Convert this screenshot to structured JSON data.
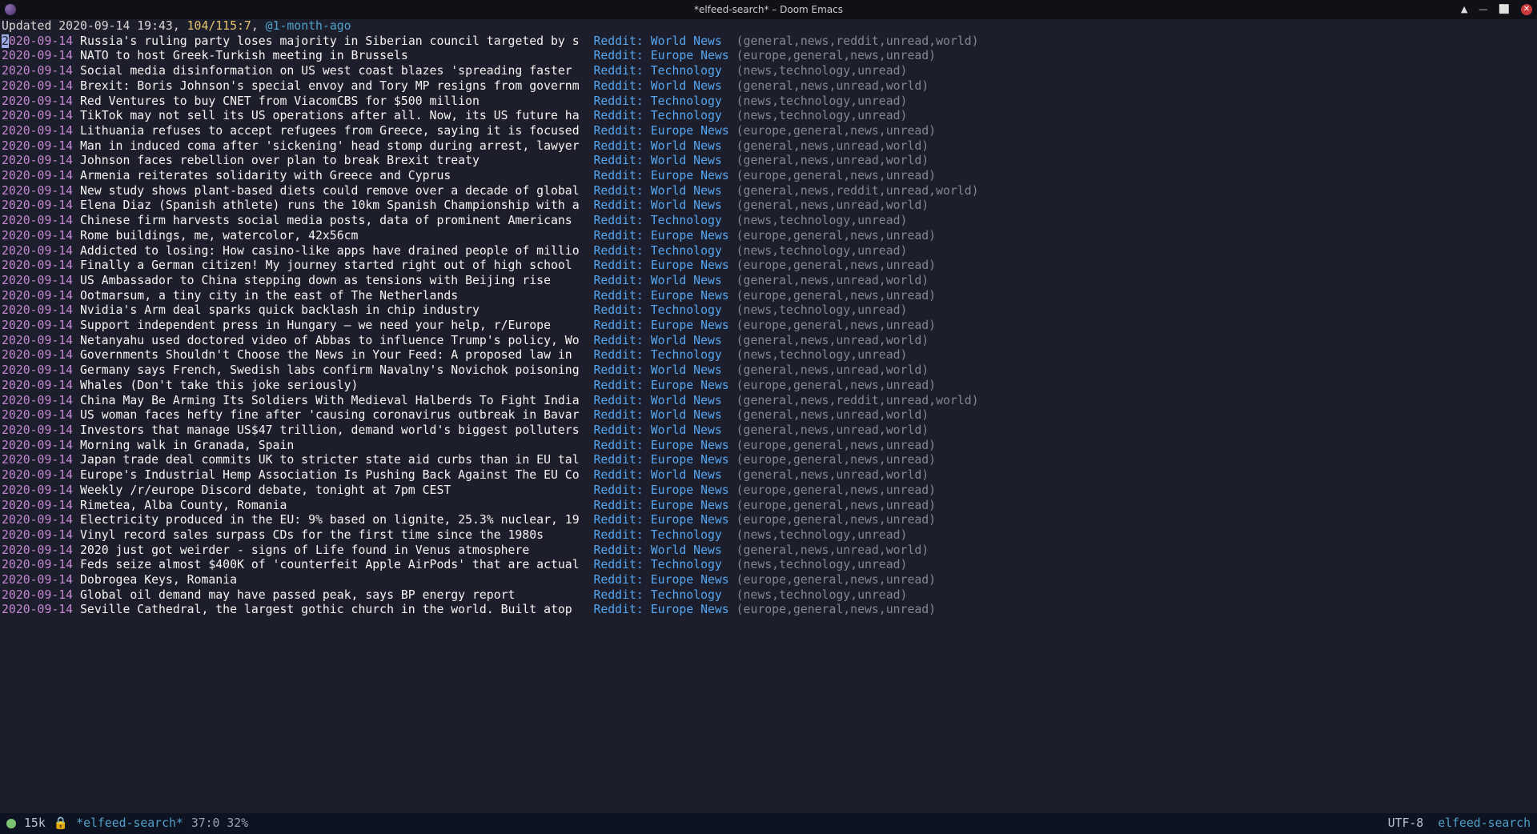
{
  "titlebar": {
    "text": "*elfeed-search* – Doom Emacs"
  },
  "header": {
    "updated_label": "Updated",
    "updated_time": "2020-09-14 19:43",
    "count": "104/115:7",
    "age": "@1-month-ago"
  },
  "feeds": {
    "world": "Reddit: World News",
    "europe": "Reddit: Europe News",
    "tech": "Reddit: Technology"
  },
  "tag_strings": {
    "world": "(general,news,unread,world)",
    "world_reddit": "(general,news,reddit,unread,world)",
    "europe": "(europe,general,news,unread)",
    "tech": "(news,technology,unread)"
  },
  "date": "2020-09-14",
  "entries": [
    {
      "t": "Russia's ruling party loses majority in Siberian council targeted by s",
      "f": "world",
      "tags": "world_reddit",
      "cursor": true
    },
    {
      "t": "NATO to host Greek-Turkish meeting in Brussels",
      "f": "europe",
      "tags": "europe"
    },
    {
      "t": "Social media disinformation on US west coast blazes 'spreading faster",
      "f": "tech",
      "tags": "tech"
    },
    {
      "t": "Brexit: Boris Johnson's special envoy and Tory MP resigns from governm",
      "f": "world",
      "tags": "world"
    },
    {
      "t": "Red Ventures to buy CNET from ViacomCBS for $500 million",
      "f": "tech",
      "tags": "tech"
    },
    {
      "t": "TikTok may not sell its US operations after all. Now, its US future ha",
      "f": "tech",
      "tags": "tech"
    },
    {
      "t": "Lithuania refuses to accept refugees from Greece, saying it is focused",
      "f": "europe",
      "tags": "europe"
    },
    {
      "t": "Man in induced coma after 'sickening' head stomp during arrest, lawyer",
      "f": "world",
      "tags": "world"
    },
    {
      "t": "Johnson faces rebellion over plan to break Brexit treaty",
      "f": "world",
      "tags": "world"
    },
    {
      "t": "Armenia reiterates solidarity with Greece and Cyprus",
      "f": "europe",
      "tags": "europe"
    },
    {
      "t": "New study shows plant-based diets could remove over a decade of global",
      "f": "world",
      "tags": "world_reddit"
    },
    {
      "t": "Elena Diaz (Spanish athlete) runs the 10km Spanish Championship with a",
      "f": "world",
      "tags": "world"
    },
    {
      "t": "Chinese firm harvests social media posts, data of prominent Americans",
      "f": "tech",
      "tags": "tech"
    },
    {
      "t": "Rome buildings, me, watercolor, 42x56cm",
      "f": "europe",
      "tags": "europe"
    },
    {
      "t": "Addicted to losing: How casino-like apps have drained people of millio",
      "f": "tech",
      "tags": "tech"
    },
    {
      "t": "Finally a German citizen! My journey started right out of high school",
      "f": "europe",
      "tags": "europe"
    },
    {
      "t": "US Ambassador to China stepping down as tensions with Beijing rise",
      "f": "world",
      "tags": "world"
    },
    {
      "t": "Ootmarsum, a tiny city in the east of The Netherlands",
      "f": "europe",
      "tags": "europe"
    },
    {
      "t": "Nvidia's Arm deal sparks quick backlash in chip industry",
      "f": "tech",
      "tags": "tech"
    },
    {
      "t": "Support independent press in Hungary – we need your help, r/Europe",
      "f": "europe",
      "tags": "europe"
    },
    {
      "t": "Netanyahu used doctored video of Abbas to influence Trump's policy, Wo",
      "f": "world",
      "tags": "world"
    },
    {
      "t": "Governments Shouldn't Choose the News in Your Feed: A proposed law in",
      "f": "tech",
      "tags": "tech"
    },
    {
      "t": "Germany says French, Swedish labs confirm Navalny's Novichok poisoning",
      "f": "world",
      "tags": "world"
    },
    {
      "t": "Whales (Don't take this joke seriously)",
      "f": "europe",
      "tags": "europe"
    },
    {
      "t": "China May Be Arming Its Soldiers With Medieval Halberds To Fight India",
      "f": "world",
      "tags": "world_reddit"
    },
    {
      "t": "US woman faces hefty fine after 'causing coronavirus outbreak in Bavar",
      "f": "world",
      "tags": "world"
    },
    {
      "t": "Investors that manage US$47 trillion, demand world's biggest polluters",
      "f": "world",
      "tags": "world"
    },
    {
      "t": "Morning walk in Granada, Spain",
      "f": "europe",
      "tags": "europe"
    },
    {
      "t": "Japan trade deal commits UK to stricter state aid curbs than in EU tal",
      "f": "europe",
      "tags": "europe"
    },
    {
      "t": "Europe's Industrial Hemp Association Is Pushing Back Against The EU Co",
      "f": "world",
      "tags": "world"
    },
    {
      "t": "Weekly /r/europe Discord debate, tonight at 7pm CEST",
      "f": "europe",
      "tags": "europe"
    },
    {
      "t": "Rimetea, Alba County, Romania",
      "f": "europe",
      "tags": "europe"
    },
    {
      "t": "Electricity produced in the EU: 9% based on lignite, 25.3% nuclear, 19",
      "f": "europe",
      "tags": "europe"
    },
    {
      "t": "Vinyl record sales surpass CDs for the first time since the 1980s",
      "f": "tech",
      "tags": "tech"
    },
    {
      "t": "2020 just got weirder - signs of Life found in Venus atmosphere",
      "f": "world",
      "tags": "world"
    },
    {
      "t": "Feds seize almost $400K of 'counterfeit Apple AirPods' that are actual",
      "f": "tech",
      "tags": "tech"
    },
    {
      "t": "Dobrogea Keys, Romania",
      "f": "europe",
      "tags": "europe"
    },
    {
      "t": "Global oil demand may have passed peak, says BP energy report",
      "f": "tech",
      "tags": "tech"
    },
    {
      "t": "Seville Cathedral, the largest gothic church in the world. Built atop",
      "f": "europe",
      "tags": "europe"
    }
  ],
  "modeline": {
    "size": "15k",
    "lock": "🔒",
    "bufname": "*elfeed-search*",
    "pos": "37:0 32%",
    "encoding": "UTF-8",
    "mode": "elfeed-search"
  }
}
